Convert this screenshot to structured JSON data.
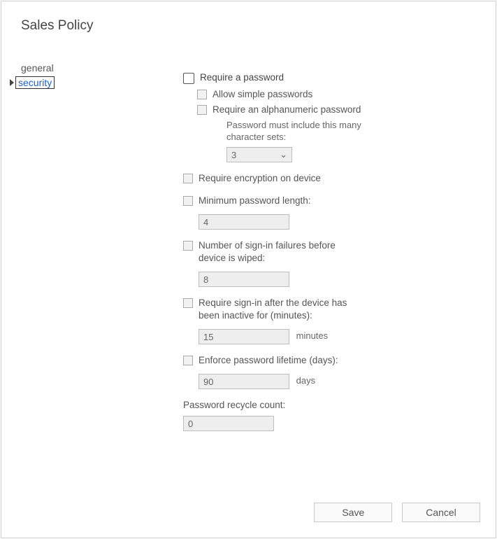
{
  "title": "Sales Policy",
  "sidebar": {
    "general": "general",
    "security": "security"
  },
  "form": {
    "require_password": "Require a password",
    "allow_simple": "Allow simple passwords",
    "require_alnum": "Require an alphanumeric password",
    "charsets_caption": "Password must include this many character sets:",
    "charsets_value": "3",
    "require_encryption": "Require encryption on device",
    "min_length_label": "Minimum password length:",
    "min_length_value": "4",
    "failures_label": "Number of sign-in failures before device is wiped:",
    "failures_value": "8",
    "inactive_label": "Require sign-in after the device has been inactive for (minutes):",
    "inactive_value": "15",
    "inactive_unit": "minutes",
    "lifetime_label": "Enforce password lifetime (days):",
    "lifetime_value": "90",
    "lifetime_unit": "days",
    "recycle_label": "Password recycle count:",
    "recycle_value": "0"
  },
  "buttons": {
    "save": "Save",
    "cancel": "Cancel"
  }
}
